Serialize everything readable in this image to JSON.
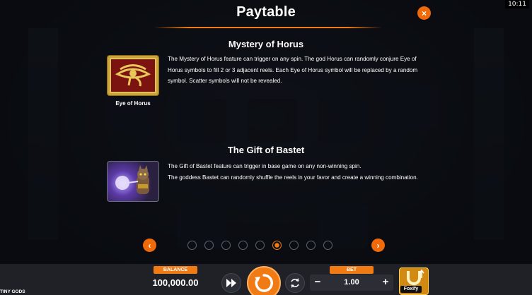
{
  "clock": "10:11",
  "header": {
    "title": "Paytable",
    "close_label": "×"
  },
  "sections": [
    {
      "title": "Mystery of Horus",
      "symbol_caption": "Eye of Horus",
      "description": "The Mystery of Horus feature can trigger on any spin. The god Horus can randomly conjure Eye of Horus symbols to fill 2 or 3 adjacent reels. Each Eye of Horus symbol will be replaced by a random symbol. Scatter symbols will not be revealed."
    },
    {
      "title": "The Gift of Bastet",
      "description_lines": [
        "The Gift of Bastet feature can trigger in base game on any non-winning spin.",
        "The goddess Bastet can randomly shuffle the reels in your favor and create a winning combination."
      ]
    }
  ],
  "pagination": {
    "total": 9,
    "active": 6,
    "prev_icon": "‹",
    "next_icon": "›"
  },
  "bottom_bar": {
    "balance_label": "BALANCE",
    "balance_value": "100,000.00",
    "bet_label": "BET",
    "bet_value": "1.00",
    "bet_minus": "−",
    "bet_plus": "+",
    "feature_label": "Foxify",
    "game_name": "TINY GODS"
  },
  "colors": {
    "accent": "#f07a14",
    "overlay": "#0c0f14",
    "bar": "#1f2126"
  }
}
